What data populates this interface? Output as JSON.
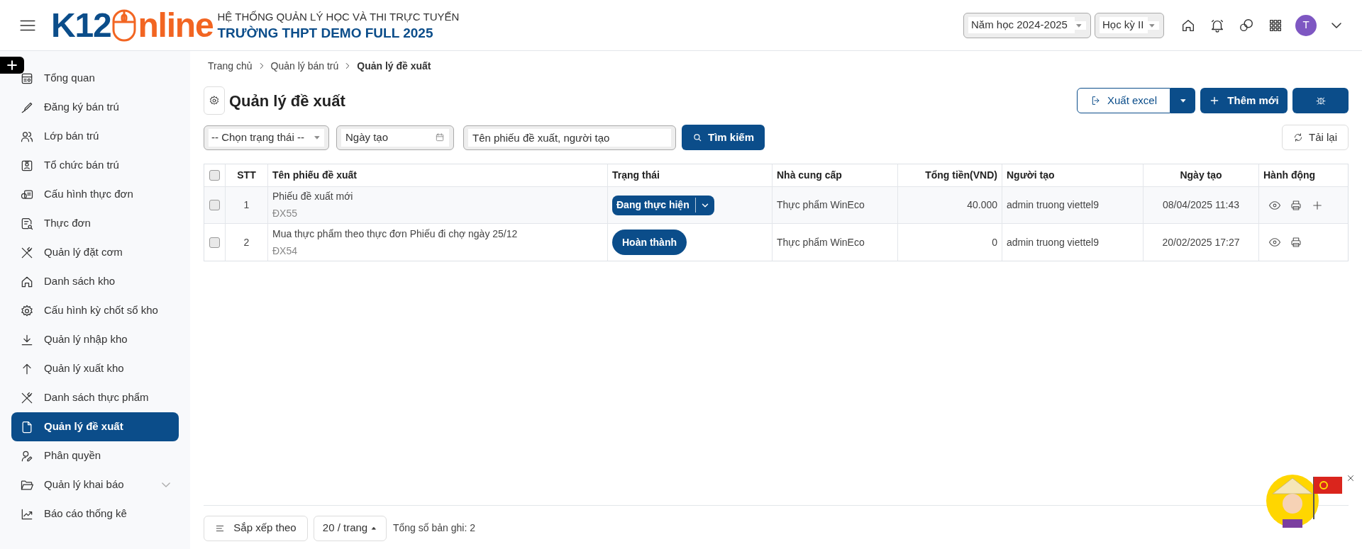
{
  "header": {
    "logo": {
      "left": "K12",
      "right": "nline"
    },
    "system_name": "HỆ THỐNG QUẢN LÝ HỌC VÀ THI TRỰC TUYẾN",
    "school_name": "TRƯỜNG THPT DEMO FULL 2025",
    "school_year": "Năm học 2024-2025",
    "semester": "Học kỳ II",
    "avatar_letter": "T"
  },
  "sidebar": {
    "items": [
      {
        "label": "Tổng quan",
        "selected": false,
        "expandable": false
      },
      {
        "label": "Đăng ký bán trú",
        "selected": false,
        "expandable": false
      },
      {
        "label": "Lớp bán trú",
        "selected": false,
        "expandable": false
      },
      {
        "label": "Tổ chức bán trú",
        "selected": false,
        "expandable": false
      },
      {
        "label": "Cấu hình thực đơn",
        "selected": false,
        "expandable": false
      },
      {
        "label": "Thực đơn",
        "selected": false,
        "expandable": false
      },
      {
        "label": "Quản lý đặt cơm",
        "selected": false,
        "expandable": false
      },
      {
        "label": "Danh sách kho",
        "selected": false,
        "expandable": false
      },
      {
        "label": "Cấu hình kỳ chốt sổ kho",
        "selected": false,
        "expandable": false
      },
      {
        "label": "Quản lý nhập kho",
        "selected": false,
        "expandable": false
      },
      {
        "label": "Quản lý xuất kho",
        "selected": false,
        "expandable": false
      },
      {
        "label": "Danh sách thực phẩm",
        "selected": false,
        "expandable": false
      },
      {
        "label": "Quản lý đề xuất",
        "selected": true,
        "expandable": false
      },
      {
        "label": "Phân quyền",
        "selected": false,
        "expandable": false
      },
      {
        "label": "Quản lý khai báo",
        "selected": false,
        "expandable": true
      },
      {
        "label": "Báo cáo thống kê",
        "selected": false,
        "expandable": false
      }
    ]
  },
  "breadcrumb": [
    "Trang chủ",
    "Quản lý bán trú",
    "Quản lý đề xuất"
  ],
  "page_title": "Quản lý đề xuất",
  "toolbar": {
    "export": "Xuất excel",
    "add": "Thêm mới",
    "reload": "Tải lại"
  },
  "filters": {
    "status": "-- Chọn trạng thái --",
    "date": "Ngày tạo",
    "search_placeholder": "Tên phiếu đề xuất, người tạo",
    "search_button": "Tìm kiếm"
  },
  "table": {
    "header_checked": false,
    "columns": [
      "STT",
      "Tên phiếu đề xuất",
      "Trạng thái",
      "Nhà cung cấp",
      "Tổng tiền(VND)",
      "Người tạo",
      "Ngày tạo",
      "Hành động"
    ],
    "rows": [
      {
        "checked": false,
        "stt": "1",
        "name": "Phiếu đề xuất mới",
        "code": "ĐX55",
        "status": "Đang thực hiện",
        "kind": "dropdown",
        "supplier": "Thực phẩm WinEco",
        "total": "40.000",
        "creator": "admin truong viettel9",
        "created": "08/04/2025 11:43",
        "can_add": true
      },
      {
        "checked": false,
        "stt": "2",
        "name": "Mua thực phẩm theo thực đơn Phiếu đi chợ ngày 25/12",
        "code": "ĐX54",
        "status": "Hoàn thành",
        "kind": "pill",
        "supplier": "Thực phẩm WinEco",
        "total": "0",
        "creator": "admin truong viettel9",
        "created": "20/02/2025 17:27",
        "can_add": false
      }
    ]
  },
  "footer": {
    "sort": "Sắp xếp theo",
    "page_size": "20 / trang",
    "total": "Tổng số bản ghi: 2"
  }
}
